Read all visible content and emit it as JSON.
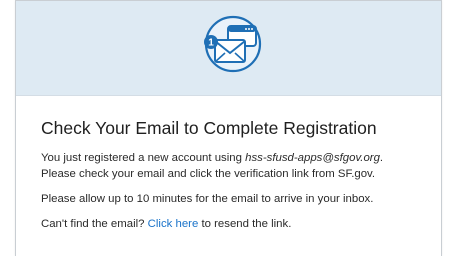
{
  "card": {
    "header_icon": "email-notification-icon",
    "notification_count": "1",
    "title": "Check Your Email to Complete Registration",
    "line1_prefix": "You just registered a new account using ",
    "email": "hss-sfusd-apps@sfgov.org",
    "line1_suffix": ".",
    "line2": "Please check your email and click the verification link from SF.gov.",
    "wait_text": "Please allow up to 10 minutes for the email to arrive in your inbox.",
    "resend_prefix": "Can't find the email? ",
    "resend_link": "Click here",
    "resend_suffix": " to resend the link."
  },
  "colors": {
    "header_bg": "#deeaf3",
    "icon_blue": "#1f6fb5",
    "link": "#1a73c9"
  }
}
